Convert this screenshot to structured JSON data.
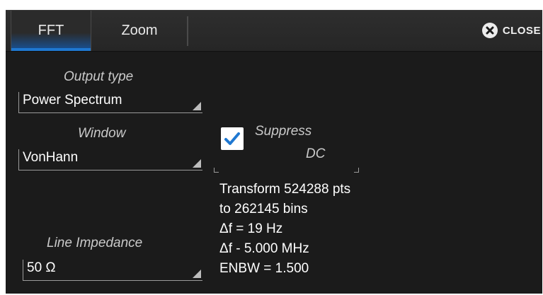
{
  "tabs": [
    {
      "label": "FFT",
      "active": true
    },
    {
      "label": "Zoom",
      "active": false
    }
  ],
  "close_label": "CLOSE",
  "output_type": {
    "label": "Output type",
    "value": "Power Spectrum"
  },
  "window": {
    "label": "Window",
    "value": "VonHann"
  },
  "line_impedance": {
    "label": "Line Impedance",
    "value": "50 Ω"
  },
  "suppress_dc": {
    "label_line1": "Suppress",
    "label_line2": "DC",
    "checked": true
  },
  "info_lines": [
    "Transform 524288 pts",
    "to 262145 bins",
    "Δf = 19 Hz",
    "Δf - 5.000 MHz",
    "ENBW = 1.500"
  ],
  "colors": {
    "background": "#1b1b1b",
    "accent": "#1f78d1",
    "text": "#ffffff",
    "label": "#c9c9c9"
  }
}
